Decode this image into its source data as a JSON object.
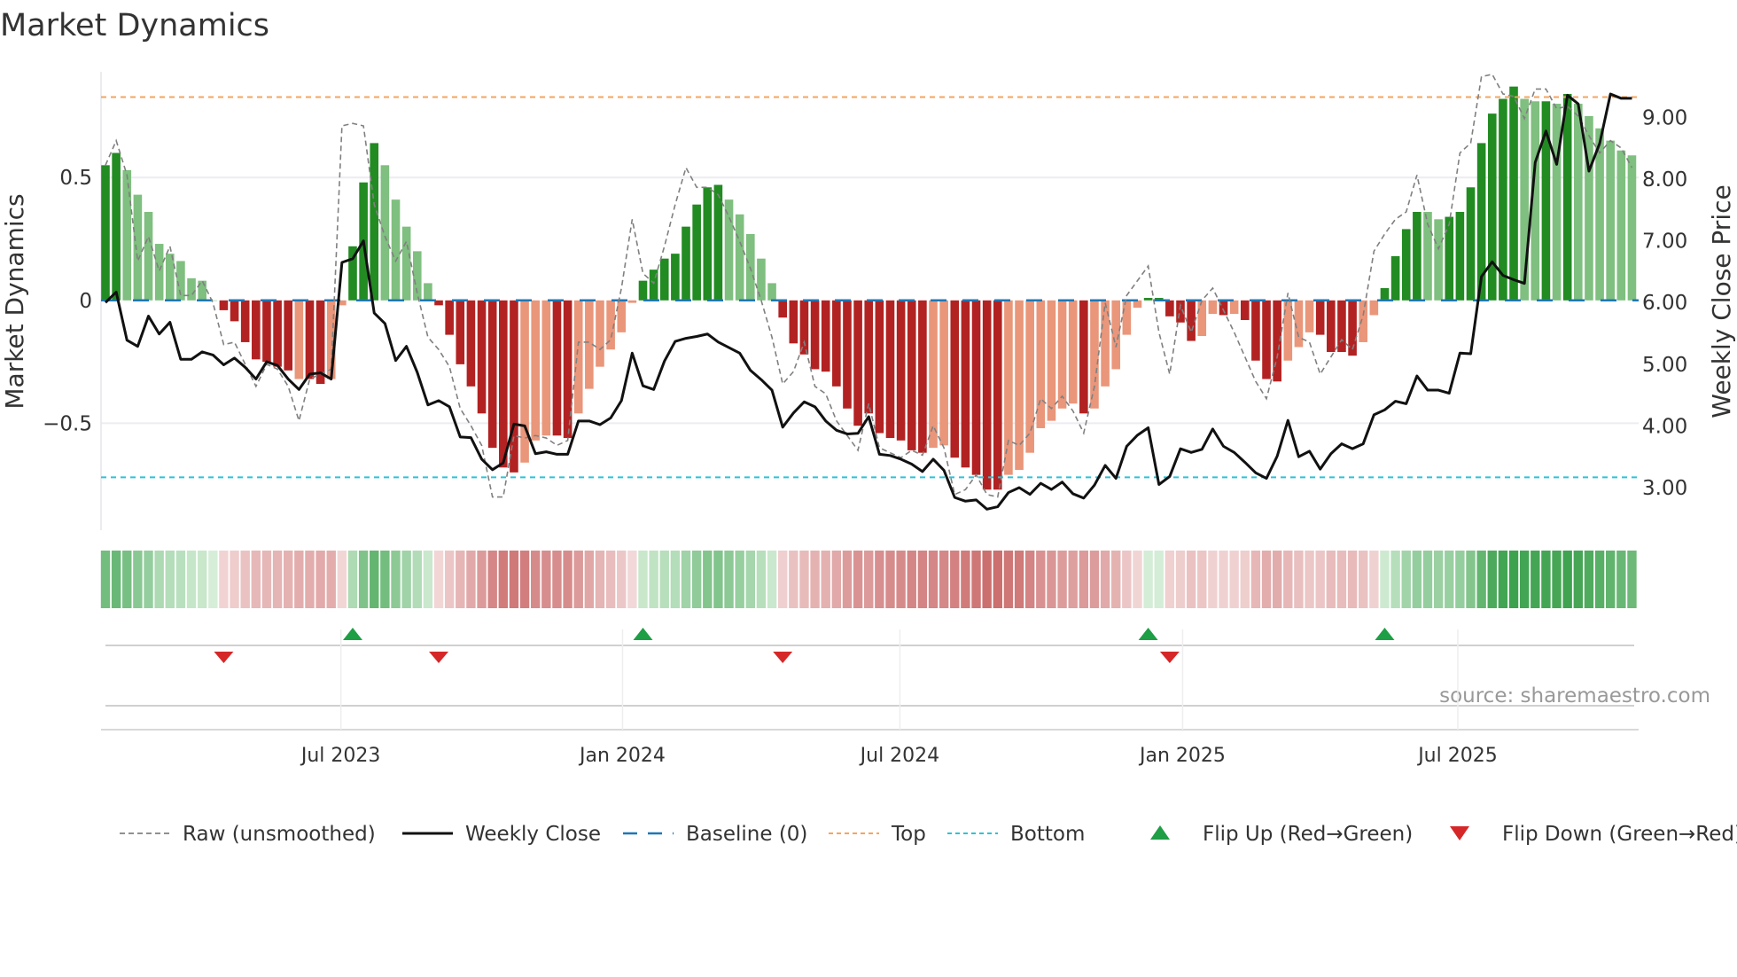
{
  "chart_data": {
    "type": "bar",
    "title": "Market Dynamics",
    "ylabel": "Market Dynamics",
    "y2label": "Weekly Close Price",
    "ylim": [
      -0.935,
      0.93
    ],
    "y2lim": [
      2.31,
      9.74
    ],
    "yticks": [
      {
        "v": 0.5,
        "label": "0.5"
      },
      {
        "v": 0,
        "label": "0"
      },
      {
        "v": -0.5,
        "label": "−0.5"
      }
    ],
    "y2ticks": [
      {
        "v": 9,
        "label": "9.00"
      },
      {
        "v": 8,
        "label": "8.00"
      },
      {
        "v": 7,
        "label": "7.00"
      },
      {
        "v": 6,
        "label": "6.00"
      },
      {
        "v": 5,
        "label": "5.00"
      },
      {
        "v": 4,
        "label": "4.00"
      },
      {
        "v": 3,
        "label": "3.00"
      }
    ],
    "xticks": [
      {
        "week": 21.9,
        "label": "Jul 2023"
      },
      {
        "week": 48.1,
        "label": "Jan 2024"
      },
      {
        "week": 73.9,
        "label": "Jul 2024"
      },
      {
        "week": 100.2,
        "label": "Jan 2025"
      },
      {
        "week": 125.8,
        "label": "Jul 2025"
      }
    ],
    "top_level": 0.827,
    "bottom_level": -0.72,
    "baseline": 0,
    "dynamics": [
      0.55,
      0.6,
      0.53,
      0.43,
      0.36,
      0.23,
      0.19,
      0.16,
      0.09,
      0.08,
      0.0,
      -0.04,
      -0.085,
      -0.17,
      -0.24,
      -0.25,
      -0.27,
      -0.285,
      -0.32,
      -0.32,
      -0.34,
      -0.32,
      -0.02,
      0.22,
      0.48,
      0.64,
      0.55,
      0.41,
      0.3,
      0.2,
      0.07,
      -0.02,
      -0.14,
      -0.26,
      -0.35,
      -0.46,
      -0.6,
      -0.68,
      -0.7,
      -0.66,
      -0.57,
      -0.55,
      -0.55,
      -0.56,
      -0.46,
      -0.36,
      -0.27,
      -0.2,
      -0.13,
      -0.01,
      0.08,
      0.125,
      0.17,
      0.19,
      0.3,
      0.39,
      0.46,
      0.47,
      0.41,
      0.35,
      0.27,
      0.17,
      0.07,
      -0.07,
      -0.175,
      -0.22,
      -0.28,
      -0.29,
      -0.35,
      -0.44,
      -0.51,
      -0.46,
      -0.54,
      -0.56,
      -0.57,
      -0.61,
      -0.62,
      -0.6,
      -0.59,
      -0.64,
      -0.68,
      -0.71,
      -0.77,
      -0.77,
      -0.71,
      -0.69,
      -0.62,
      -0.52,
      -0.49,
      -0.44,
      -0.42,
      -0.46,
      -0.44,
      -0.35,
      -0.28,
      -0.14,
      -0.03,
      0.01,
      0.01,
      -0.065,
      -0.09,
      -0.165,
      -0.145,
      -0.055,
      -0.06,
      -0.055,
      -0.08,
      -0.245,
      -0.32,
      -0.33,
      -0.245,
      -0.19,
      -0.13,
      -0.14,
      -0.21,
      -0.21,
      -0.225,
      -0.17,
      -0.06,
      0.05,
      0.18,
      0.29,
      0.36,
      0.36,
      0.33,
      0.34,
      0.36,
      0.46,
      0.64,
      0.76,
      0.82,
      0.87,
      0.82,
      0.81,
      0.81,
      0.8,
      0.84,
      0.8,
      0.75,
      0.7,
      0.65,
      0.61,
      0.59
    ],
    "shade": [
      "d",
      "d",
      "l",
      "l",
      "l",
      "l",
      "l",
      "l",
      "l",
      "l",
      "l",
      "d",
      "d",
      "d",
      "d",
      "d",
      "d",
      "d",
      "l",
      "d",
      "d",
      "l",
      "l",
      "d",
      "d",
      "d",
      "l",
      "l",
      "l",
      "l",
      "l",
      "d",
      "d",
      "d",
      "d",
      "d",
      "d",
      "d",
      "d",
      "l",
      "l",
      "l",
      "d",
      "d",
      "l",
      "l",
      "l",
      "l",
      "l",
      "l",
      "d",
      "d",
      "d",
      "d",
      "d",
      "d",
      "d",
      "d",
      "l",
      "l",
      "l",
      "l",
      "l",
      "d",
      "d",
      "d",
      "d",
      "d",
      "d",
      "d",
      "d",
      "d",
      "d",
      "d",
      "d",
      "d",
      "d",
      "l",
      "l",
      "d",
      "d",
      "d",
      "d",
      "d",
      "l",
      "l",
      "l",
      "l",
      "l",
      "l",
      "l",
      "d",
      "l",
      "l",
      "l",
      "l",
      "l",
      "d",
      "d",
      "d",
      "d",
      "d",
      "l",
      "l",
      "d",
      "l",
      "d",
      "d",
      "d",
      "d",
      "l",
      "l",
      "l",
      "d",
      "d",
      "d",
      "d",
      "l",
      "l",
      "d",
      "d",
      "d",
      "d",
      "l",
      "l",
      "d",
      "d",
      "d",
      "d",
      "d",
      "d",
      "d",
      "l",
      "l",
      "d",
      "l",
      "d",
      "l",
      "l",
      "l",
      "l",
      "l",
      "l"
    ],
    "raw": [
      0.55,
      0.65,
      0.51,
      0.16,
      0.26,
      0.12,
      0.22,
      0.02,
      0.02,
      0.08,
      -0.01,
      -0.18,
      -0.17,
      -0.26,
      -0.35,
      -0.26,
      -0.28,
      -0.35,
      -0.49,
      -0.32,
      -0.3,
      -0.28,
      0.71,
      0.72,
      0.71,
      0.39,
      0.26,
      0.16,
      0.24,
      0.03,
      -0.15,
      -0.2,
      -0.27,
      -0.44,
      -0.51,
      -0.59,
      -0.8,
      -0.8,
      -0.55,
      -0.56,
      -0.55,
      -0.56,
      -0.59,
      -0.57,
      -0.17,
      -0.17,
      -0.2,
      -0.16,
      0.05,
      0.33,
      0.11,
      0.07,
      0.22,
      0.39,
      0.54,
      0.46,
      0.46,
      0.43,
      0.34,
      0.24,
      0.13,
      0.0,
      -0.15,
      -0.34,
      -0.29,
      -0.17,
      -0.35,
      -0.38,
      -0.49,
      -0.55,
      -0.61,
      -0.42,
      -0.6,
      -0.62,
      -0.64,
      -0.61,
      -0.63,
      -0.51,
      -0.6,
      -0.79,
      -0.77,
      -0.71,
      -0.79,
      -0.8,
      -0.57,
      -0.59,
      -0.54,
      -0.4,
      -0.44,
      -0.39,
      -0.45,
      -0.54,
      -0.35,
      -0.01,
      -0.19,
      0.02,
      0.08,
      0.14,
      -0.13,
      -0.3,
      -0.02,
      -0.13,
      0.0,
      0.05,
      -0.04,
      -0.13,
      -0.23,
      -0.33,
      -0.4,
      -0.23,
      0.03,
      -0.15,
      -0.17,
      -0.3,
      -0.23,
      -0.16,
      -0.2,
      -0.06,
      0.2,
      0.27,
      0.33,
      0.36,
      0.51,
      0.31,
      0.21,
      0.31,
      0.6,
      0.64,
      0.91,
      0.92,
      0.84,
      0.83,
      0.74,
      0.86,
      0.86,
      0.78,
      0.79,
      0.75,
      0.67,
      0.6,
      0.65,
      0.62,
      0.54
    ],
    "weekly_close": [
      6.0,
      6.17,
      5.39,
      5.29,
      5.78,
      5.49,
      5.68,
      5.08,
      5.08,
      5.2,
      5.15,
      4.99,
      5.1,
      4.95,
      4.76,
      5.04,
      4.98,
      4.76,
      4.59,
      4.84,
      4.86,
      4.76,
      6.65,
      6.71,
      7.0,
      5.83,
      5.66,
      5.06,
      5.29,
      4.87,
      4.34,
      4.41,
      4.31,
      3.82,
      3.81,
      3.46,
      3.29,
      3.4,
      4.03,
      4.0,
      3.55,
      3.58,
      3.54,
      3.54,
      4.08,
      4.08,
      4.02,
      4.13,
      4.41,
      5.18,
      4.65,
      4.59,
      5.05,
      5.37,
      5.42,
      5.45,
      5.49,
      5.36,
      5.27,
      5.18,
      4.9,
      4.75,
      4.58,
      3.98,
      4.21,
      4.39,
      4.31,
      4.08,
      3.93,
      3.87,
      3.88,
      4.15,
      3.54,
      3.52,
      3.46,
      3.38,
      3.26,
      3.46,
      3.28,
      2.84,
      2.78,
      2.8,
      2.65,
      2.69,
      2.92,
      3.0,
      2.89,
      3.07,
      2.97,
      3.09,
      2.9,
      2.83,
      3.04,
      3.36,
      3.15,
      3.67,
      3.85,
      3.97,
      3.05,
      3.18,
      3.63,
      3.57,
      3.62,
      3.95,
      3.67,
      3.57,
      3.41,
      3.24,
      3.15,
      3.51,
      4.09,
      3.5,
      3.59,
      3.3,
      3.55,
      3.71,
      3.63,
      3.71,
      4.18,
      4.26,
      4.4,
      4.36,
      4.81,
      4.58,
      4.58,
      4.53,
      5.18,
      5.17,
      6.42,
      6.66,
      6.44,
      6.37,
      6.31,
      8.27,
      8.78,
      8.24,
      9.36,
      9.22,
      8.13,
      8.58,
      9.38,
      9.31,
      9.31
    ],
    "flip_up_weeks": [
      23,
      50,
      97,
      119
    ],
    "flip_down_weeks": [
      11,
      31,
      63,
      99
    ],
    "colors": {
      "strong_up": "#228b22",
      "weak_up": "#7fbf7f",
      "strong_down": "#b22222",
      "weak_down": "#e9967a",
      "raw": "#808080",
      "close": "#111111",
      "baseline": "#1f77b4",
      "top": "#f4a460",
      "bottom": "#2bc4d6",
      "flip_up": "#1e9e45",
      "flip_down": "#d62728"
    },
    "legend": {
      "position": "bottom",
      "items": [
        {
          "label": "Raw (unsmoothed)",
          "kind": "raw"
        },
        {
          "label": "Weekly Close",
          "kind": "close"
        },
        {
          "label": "Baseline (0)",
          "kind": "baseline"
        },
        {
          "label": "Top",
          "kind": "top"
        },
        {
          "label": "Bottom",
          "kind": "bottom"
        },
        {
          "label": "Flip Up (Red→Green)",
          "kind": "flip_up"
        },
        {
          "label": "Flip Down (Green→Red)",
          "kind": "flip_down"
        }
      ]
    },
    "source": "source: sharemaestro.com"
  }
}
